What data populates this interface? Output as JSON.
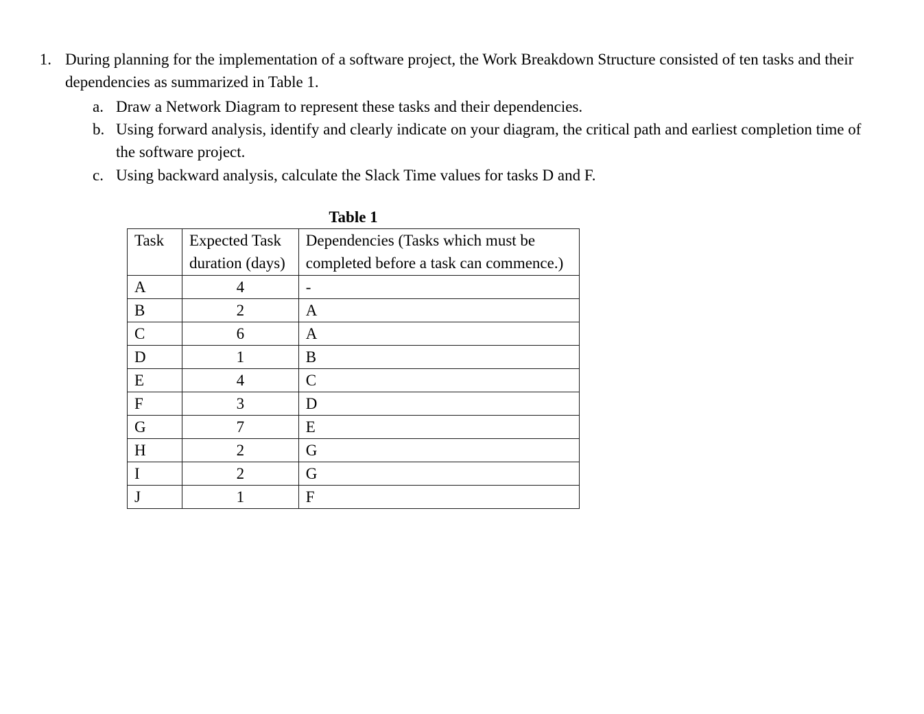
{
  "question": {
    "number": "1.",
    "intro": "During planning for the implementation of a software project, the Work Breakdown Structure consisted of ten tasks and their dependencies as summarized in Table 1.",
    "subparts": [
      {
        "letter": "a.",
        "text": "Draw a Network Diagram to represent these tasks and their dependencies."
      },
      {
        "letter": "b.",
        "text": "Using forward analysis, identify and clearly indicate on your diagram, the critical path and earliest completion time of the software project."
      },
      {
        "letter": "c.",
        "text": "Using backward analysis, calculate the Slack Time values for tasks D and F."
      }
    ]
  },
  "table": {
    "caption": "Table 1",
    "headers": {
      "task": "Task",
      "duration": "Expected Task duration (days)",
      "deps": "Dependencies (Tasks which must be completed before a task can commence.)"
    },
    "rows": [
      {
        "task": "A",
        "duration": "4",
        "deps": "-"
      },
      {
        "task": "B",
        "duration": "2",
        "deps": "A"
      },
      {
        "task": "C",
        "duration": "6",
        "deps": "A"
      },
      {
        "task": "D",
        "duration": "1",
        "deps": "B"
      },
      {
        "task": "E",
        "duration": "4",
        "deps": "C"
      },
      {
        "task": "F",
        "duration": "3",
        "deps": "D"
      },
      {
        "task": "G",
        "duration": "7",
        "deps": "E"
      },
      {
        "task": "H",
        "duration": "2",
        "deps": "G"
      },
      {
        "task": "I",
        "duration": "2",
        "deps": "G"
      },
      {
        "task": "J",
        "duration": "1",
        "deps": "F"
      }
    ]
  }
}
